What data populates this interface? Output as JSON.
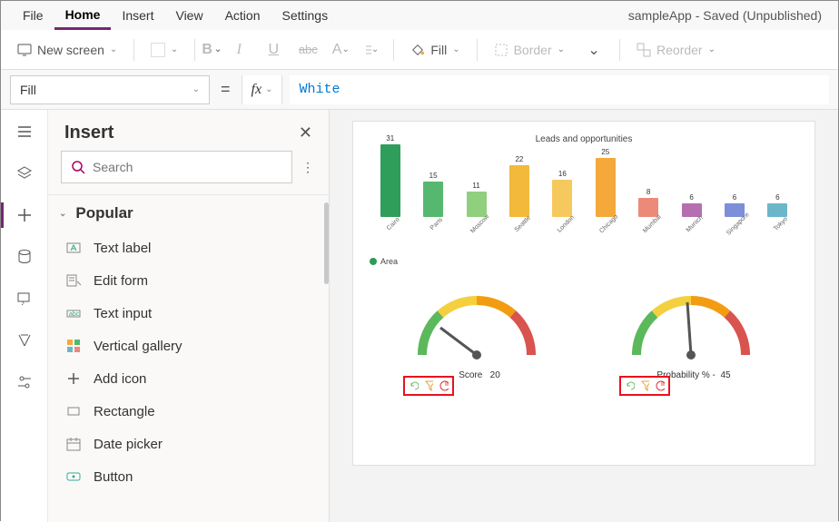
{
  "app_title": "sampleApp - Saved (Unpublished)",
  "menu": {
    "file": "File",
    "home": "Home",
    "insert": "Insert",
    "view": "View",
    "action": "Action",
    "settings": "Settings"
  },
  "toolbar": {
    "new_screen": "New screen",
    "fill": "Fill",
    "border": "Border",
    "reorder": "Reorder"
  },
  "formula": {
    "property": "Fill",
    "value": "White"
  },
  "panel": {
    "title": "Insert",
    "search_placeholder": "Search",
    "group": "Popular",
    "items": {
      "text_label": "Text label",
      "edit_form": "Edit form",
      "text_input": "Text input",
      "vertical_gallery": "Vertical gallery",
      "add_icon": "Add icon",
      "rectangle": "Rectangle",
      "date_picker": "Date picker",
      "button": "Button"
    }
  },
  "chart_data": {
    "type": "bar",
    "title": "Leads and opportunities",
    "categories": [
      "Cairo",
      "Paris",
      "Moscow",
      "Seattle",
      "London",
      "Chicago",
      "Mumbai",
      "Munich",
      "Singapore",
      "Tokyo"
    ],
    "values": [
      31,
      15,
      11,
      22,
      16,
      25,
      8,
      6,
      6,
      6
    ],
    "colors": [
      "#2f9e5b",
      "#56b86f",
      "#8fcf7e",
      "#f2b93b",
      "#f6c95f",
      "#f4a93a",
      "#ec8a79",
      "#b56fb0",
      "#7c8fd8",
      "#6bb7c9"
    ],
    "legend": "Area",
    "gauges": [
      {
        "label": "Score",
        "value": 20
      },
      {
        "label": "Probability % -",
        "value": 45
      }
    ]
  }
}
